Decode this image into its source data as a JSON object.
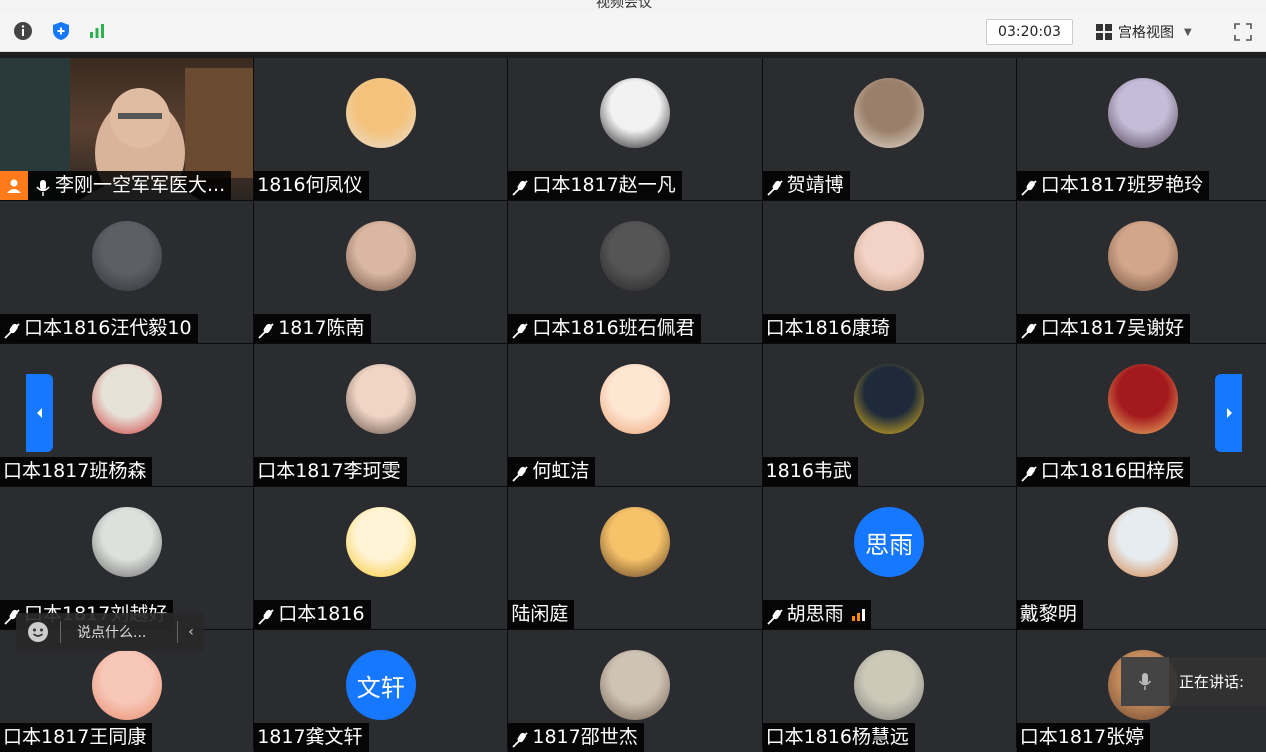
{
  "window": {
    "title": "视频会议"
  },
  "toolbar": {
    "timer": "03:20:03",
    "view_label": "宫格视图"
  },
  "tiles": [
    {
      "name": "李刚一空军军医大...",
      "muted": false,
      "video": true
    },
    {
      "name": "1816何凤仪",
      "muted": false
    },
    {
      "name": "口本1817赵一凡",
      "muted": true
    },
    {
      "name": "贺靖博",
      "muted": true
    },
    {
      "name": "口本1817班罗艳玲",
      "muted": true
    },
    {
      "name": "口本1816汪代毅10",
      "muted": true
    },
    {
      "name": "1817陈南",
      "muted": true
    },
    {
      "name": "口本1816班石佩君",
      "muted": true
    },
    {
      "name": "口本1816康琦",
      "muted": false
    },
    {
      "name": "口本1817吴谢好",
      "muted": true
    },
    {
      "name": "口本1817班杨森",
      "muted": false
    },
    {
      "name": "口本1817李珂雯",
      "muted": false
    },
    {
      "name": "何虹洁",
      "muted": true
    },
    {
      "name": "1816韦武",
      "muted": false
    },
    {
      "name": "口本1816田梓辰",
      "muted": true
    },
    {
      "name": "口本1817刘越好",
      "muted": true
    },
    {
      "name": "口本1816",
      "muted": true
    },
    {
      "name": "陆闲庭",
      "muted": false
    },
    {
      "name": "胡思雨",
      "muted": true,
      "signal": true,
      "avatar_text": "思雨"
    },
    {
      "name": "戴黎明",
      "muted": false
    },
    {
      "name": "口本1817王同康",
      "muted": false
    },
    {
      "name": "1817龚文轩",
      "muted": false,
      "avatar_text": "文轩"
    },
    {
      "name": "1817邵世杰",
      "muted": true
    },
    {
      "name": "口本1816杨慧远",
      "muted": false
    },
    {
      "name": "口本1817张婷",
      "muted": false
    }
  ],
  "chat": {
    "placeholder": "说点什么..."
  },
  "speaking": {
    "label": "正在讲话:"
  },
  "colors": {
    "accent": "#1677ff",
    "host": "#ff7a1a",
    "signal": "#ff8a00",
    "tile_bg": "#2b2c2f"
  }
}
